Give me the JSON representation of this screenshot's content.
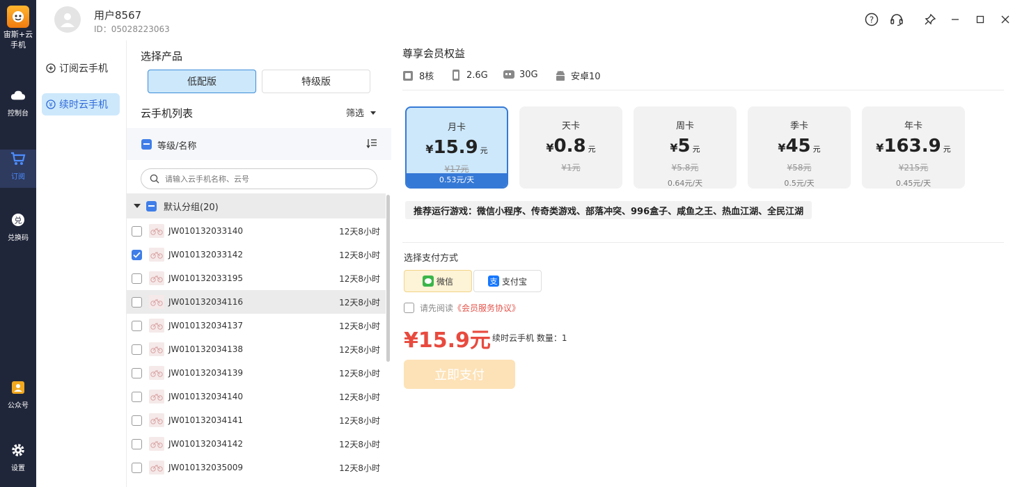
{
  "rail": {
    "logo_text": "宙斯+云\n手机",
    "items": [
      {
        "label": "控制台",
        "icon": "cloud-icon"
      },
      {
        "label": "订阅",
        "icon": "cart-icon"
      },
      {
        "label": "兑换码",
        "icon": "redeem-icon"
      },
      {
        "label": "公众号",
        "icon": "official-account-icon"
      },
      {
        "label": "设置",
        "icon": "gear-icon"
      }
    ]
  },
  "header": {
    "username": "用户8567",
    "user_id": "ID：05028223063"
  },
  "nav2": {
    "items": [
      {
        "label": "订阅云手机"
      },
      {
        "label": "续时云手机"
      }
    ]
  },
  "product": {
    "title": "选择产品",
    "options": [
      {
        "label": "低配版"
      },
      {
        "label": "特级版"
      }
    ]
  },
  "device_list": {
    "title": "云手机列表",
    "filter_label": "筛选",
    "column_header": "等级/名称",
    "search_placeholder": "请输入云手机名称、云号",
    "group_label": "默认分组(20)",
    "rows": [
      {
        "name": "JW010132033140",
        "time": "12天8小时"
      },
      {
        "name": "JW010132033142",
        "time": "12天8小时"
      },
      {
        "name": "JW010132033195",
        "time": "12天8小时"
      },
      {
        "name": "JW010132034116",
        "time": "12天8小时"
      },
      {
        "name": "JW010132034137",
        "time": "12天8小时"
      },
      {
        "name": "JW010132034138",
        "time": "12天8小时"
      },
      {
        "name": "JW010132034139",
        "time": "12天8小时"
      },
      {
        "name": "JW010132034140",
        "time": "12天8小时"
      },
      {
        "name": "JW010132034141",
        "time": "12天8小时"
      },
      {
        "name": "JW010132034142",
        "time": "12天8小时"
      },
      {
        "name": "JW010132035009",
        "time": "12天8小时"
      }
    ]
  },
  "benefits": {
    "title": "尊享会员权益",
    "specs": [
      {
        "label": "8核",
        "icon": "cpu-icon"
      },
      {
        "label": "2.6G",
        "icon": "memory-icon"
      },
      {
        "label": "30G",
        "icon": "storage-icon"
      },
      {
        "label": "安卓10",
        "icon": "android-icon"
      }
    ]
  },
  "plans": [
    {
      "name": "月卡",
      "yen": "¥",
      "price": "15.9",
      "unit": "元",
      "original": "¥17元",
      "daily": "0.53元/天"
    },
    {
      "name": "天卡",
      "yen": "¥",
      "price": "0.8",
      "unit": "元",
      "original": "¥1元",
      "daily": ""
    },
    {
      "name": "周卡",
      "yen": "¥",
      "price": "5",
      "unit": "元",
      "original": "¥5.8元",
      "daily": "0.64元/天"
    },
    {
      "name": "季卡",
      "yen": "¥",
      "price": "45",
      "unit": "元",
      "original": "¥58元",
      "daily": "0.5元/天"
    },
    {
      "name": "年卡",
      "yen": "¥",
      "price": "163.9",
      "unit": "元",
      "original": "¥215元",
      "daily": "0.45元/天"
    }
  ],
  "recommend": "推荐运行游戏：微信小程序、传奇类游戏、部落冲突、996盒子、咸鱼之王、热血江湖、全民江湖",
  "payment": {
    "title": "选择支付方式",
    "methods": [
      {
        "label": "微信",
        "icon": "wechat-icon"
      },
      {
        "label": "支付宝",
        "icon": "alipay-icon"
      }
    ],
    "agree_prefix": "请先阅读",
    "agree_link": "《会员服务协议》",
    "total": "¥15.9元",
    "total_note": "续时云手机 数量：1",
    "pay_button": "立即支付"
  },
  "colors": {
    "rail_bg": "#20263a",
    "accent": "#3579d6",
    "price_red": "#e84a3e"
  }
}
